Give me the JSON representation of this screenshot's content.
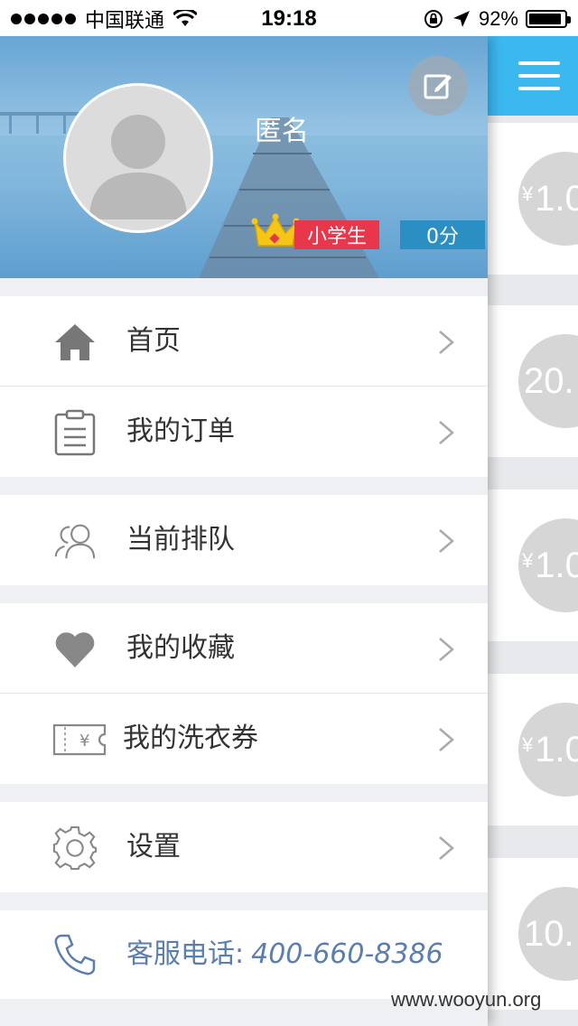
{
  "status_bar": {
    "carrier": "中国联通",
    "time": "19:18",
    "battery": "92%",
    "battery_level": 0.92
  },
  "profile": {
    "username": "匿名",
    "level": "小学生",
    "score": "0分",
    "edit_icon": "edit-icon",
    "avatar_icon": "default-user-icon"
  },
  "menu": {
    "home": "首页",
    "orders": "我的订单",
    "queue": "当前排队",
    "favorites": "我的收藏",
    "coupons": "我的洗衣券",
    "settings": "设置"
  },
  "service": {
    "label": "客服电话:",
    "phone": "400-660-8386"
  },
  "right_panel": {
    "cards": [
      {
        "yen": "¥",
        "amount": "1.0"
      },
      {
        "yen": "",
        "amount": "20."
      },
      {
        "yen": "¥",
        "amount": "1.0"
      },
      {
        "yen": "¥",
        "amount": "1.0"
      },
      {
        "yen": "",
        "amount": "10."
      }
    ]
  },
  "watermark": "www.wooyun.org",
  "colors": {
    "accent": "#3cb8f0",
    "level_badge": "#e8364a",
    "score_badge": "#2b8fc4",
    "phone_text": "#5a7eb0"
  }
}
